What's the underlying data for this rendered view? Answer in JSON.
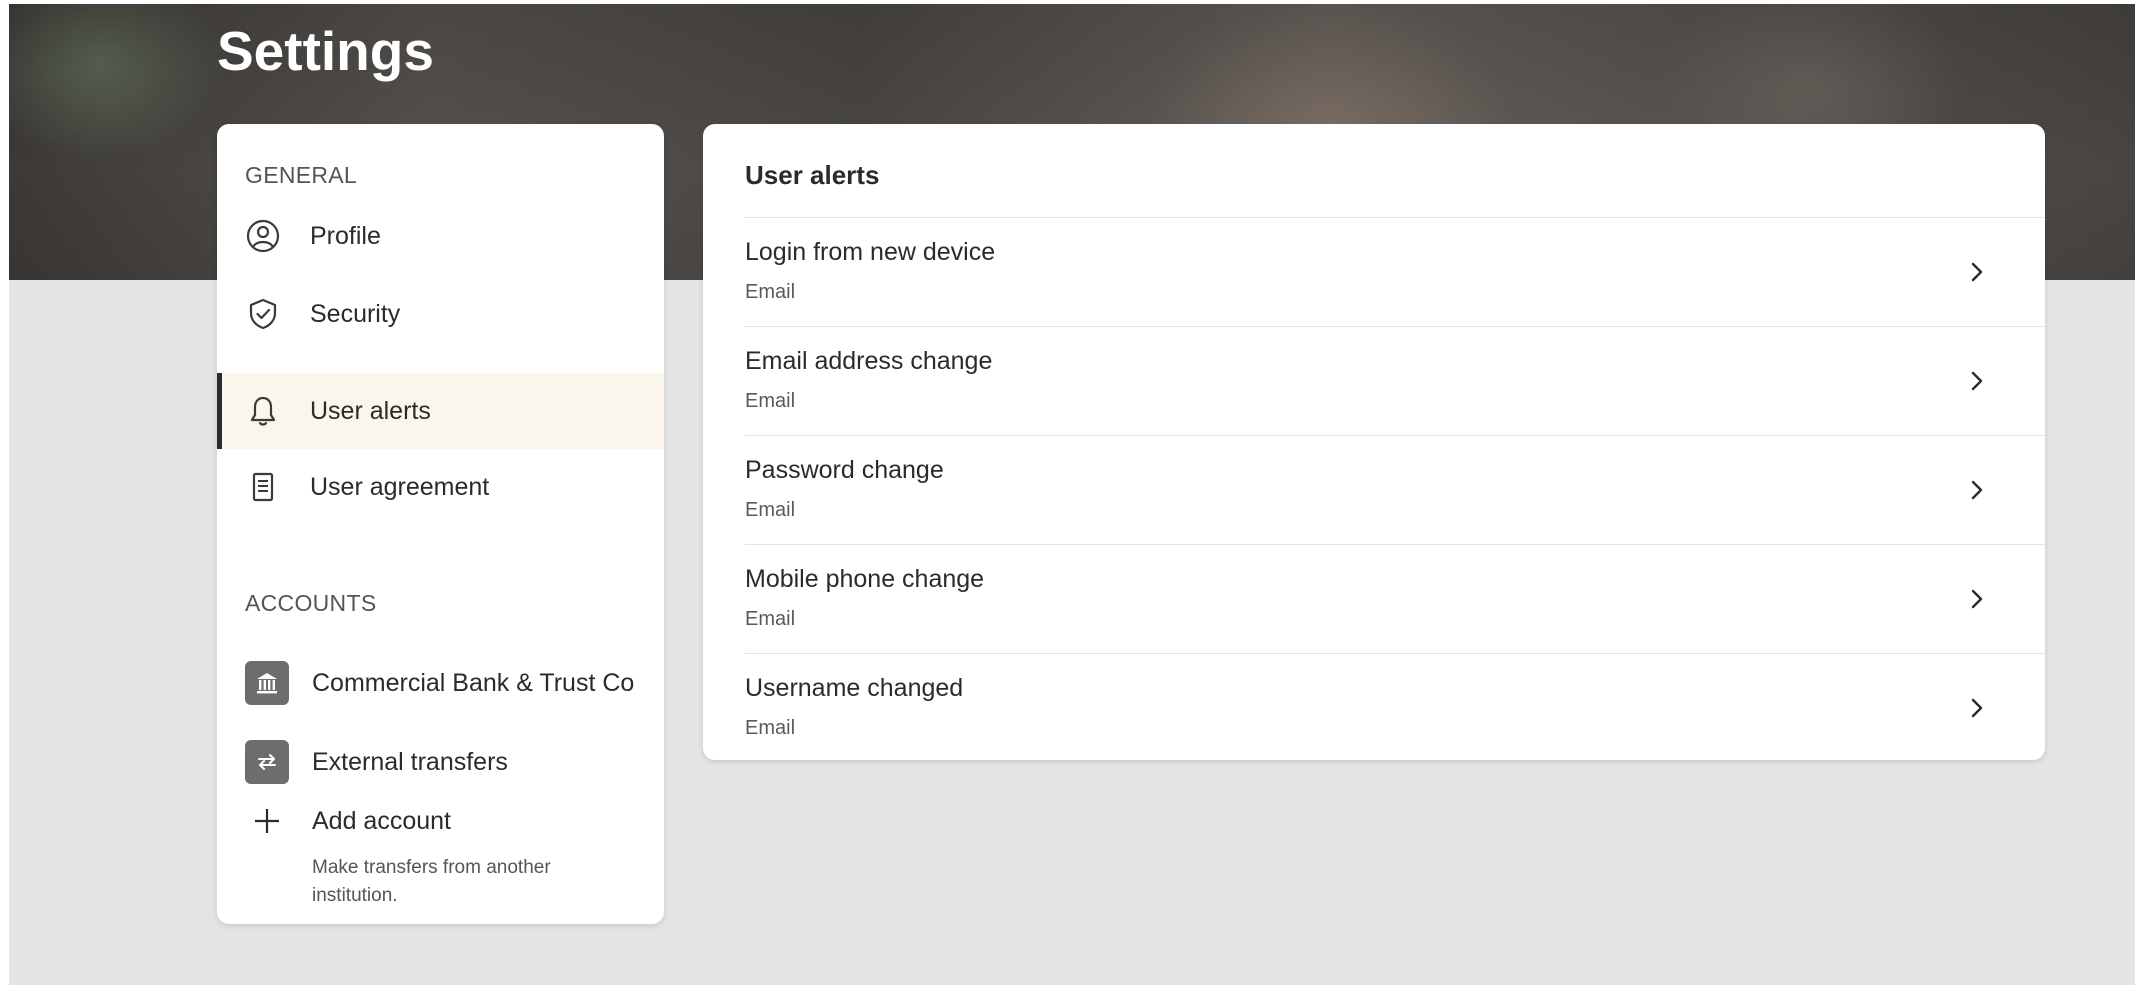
{
  "page": {
    "title": "Settings"
  },
  "sidebar": {
    "general_heading": "GENERAL",
    "items": [
      {
        "label": "Profile",
        "icon": "person-circle-icon"
      },
      {
        "label": "Security",
        "icon": "shield-check-icon"
      },
      {
        "label": "User alerts",
        "icon": "bell-icon",
        "active": true
      },
      {
        "label": "User agreement",
        "icon": "document-icon"
      }
    ],
    "accounts_heading": "ACCOUNTS",
    "accounts": [
      {
        "label": "Commercial Bank & Trust Co",
        "icon": "bank-icon"
      },
      {
        "label": "External transfers",
        "icon": "transfer-arrows-icon"
      }
    ],
    "add_account": {
      "label": "Add account",
      "description": "Make transfers from another institution.",
      "icon": "plus-icon"
    }
  },
  "main": {
    "title": "User alerts",
    "alerts": [
      {
        "name": "Login from new device",
        "channel": "Email"
      },
      {
        "name": "Email address change",
        "channel": "Email"
      },
      {
        "name": "Password change",
        "channel": "Email"
      },
      {
        "name": "Mobile phone change",
        "channel": "Email"
      },
      {
        "name": "Username changed",
        "channel": "Email"
      }
    ]
  },
  "colors": {
    "active_bg": "#faf6ec",
    "active_border": "#2b2b2b",
    "page_bg": "#e4e4e4",
    "card_bg": "#ffffff",
    "account_icon_bg": "#6d6d6d"
  }
}
